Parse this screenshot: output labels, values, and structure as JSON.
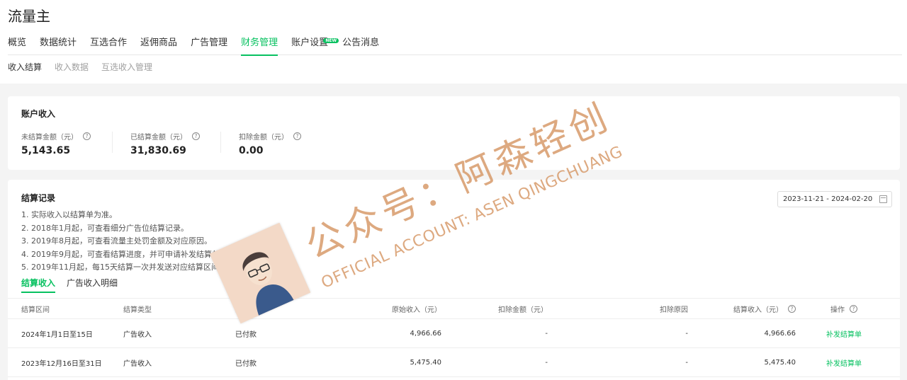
{
  "app": {
    "title": "流量主"
  },
  "main_tabs": [
    {
      "label": "概览"
    },
    {
      "label": "数据统计"
    },
    {
      "label": "互选合作"
    },
    {
      "label": "返佣商品"
    },
    {
      "label": "广告管理"
    },
    {
      "label": "财务管理",
      "active": true
    },
    {
      "label": "账户设置",
      "badge": "NEW"
    },
    {
      "label": "公告消息"
    }
  ],
  "sub_tabs": [
    {
      "label": "收入结算",
      "active": true
    },
    {
      "label": "收入数据"
    },
    {
      "label": "互选收入管理"
    }
  ],
  "income": {
    "title": "账户收入",
    "stats": [
      {
        "label": "未结算金额（元）",
        "value": "5,143.65"
      },
      {
        "label": "已结算金额（元）",
        "value": "31,830.69"
      },
      {
        "label": "扣除金额（元）",
        "value": "0.00"
      }
    ]
  },
  "records": {
    "title": "结算记录",
    "date_range": "2023-11-21 - 2024-02-20",
    "notes": [
      "1. 实际收入以结算单为准。",
      "2. 2018年1月起，可查看细分广告位结算记录。",
      "3. 2019年8月起，可查看流量主处罚金额及对应原因。",
      "4. 2019年9月起，可查看结算进度，并可申请补发结算单。",
      "5. 2019年11月起，每15天结算一次并发送对应结算区间的结算单。"
    ],
    "tabs": [
      {
        "label": "结算收入",
        "active": true
      },
      {
        "label": "广告收入明细"
      }
    ],
    "columns": {
      "period": "结算区间",
      "type": "结算类型",
      "status": "结算状态",
      "original": "原始收入（元）",
      "deduction": "扣除金额（元）",
      "reason": "扣除原因",
      "settled": "结算收入（元）",
      "action": "操作"
    },
    "rows": [
      {
        "period": "2024年1月1日至15日",
        "type": "广告收入",
        "status": "已付款",
        "original": "4,966.66",
        "deduction": "-",
        "reason": "-",
        "settled": "4,966.66",
        "action": "补发结算单"
      },
      {
        "period": "2023年12月16日至31日",
        "type": "广告收入",
        "status": "已付款",
        "original": "5,475.40",
        "deduction": "-",
        "reason": "-",
        "settled": "5,475.40",
        "action": "补发结算单"
      }
    ]
  },
  "watermark": {
    "cn": "公众号：阿森轻创",
    "en": "OFFICIAL ACCOUNT: ASEN QINGCHUANG"
  },
  "colors": {
    "accent": "#07c160",
    "watermark": "#d69664"
  },
  "icons": [
    "help-icon",
    "calendar-icon",
    "avatar"
  ]
}
